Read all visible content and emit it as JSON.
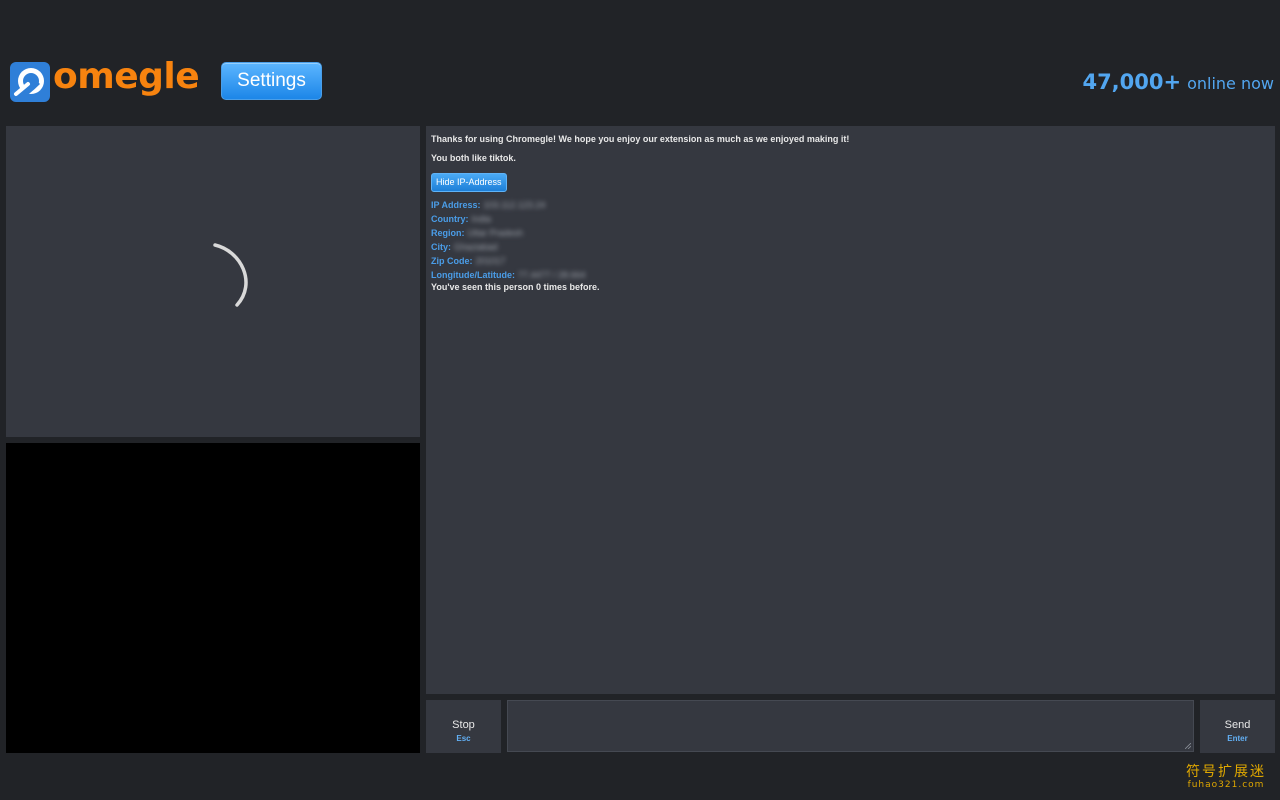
{
  "header": {
    "logo_text": "omegle",
    "settings_label": "Settings",
    "online_count": "47,000+",
    "online_label": "online now"
  },
  "chat": {
    "message_thanks": "Thanks for using Chromegle! We hope you enjoy our extension as much as we enjoyed making it!",
    "message_common": "You both like tiktok.",
    "hide_ip_label": "Hide IP-Address",
    "info": [
      {
        "key": "IP Address:",
        "value": "103.112.123.24"
      },
      {
        "key": "Country:",
        "value": "India"
      },
      {
        "key": "Region:",
        "value": "Uttar Pradesh"
      },
      {
        "key": "City:",
        "value": "Ghaziabad"
      },
      {
        "key": "Zip Code:",
        "value": "201017"
      },
      {
        "key": "Longitude/Latitude:",
        "value": "77.4477 / 28.664"
      }
    ],
    "message_seen": "You've seen this person 0 times before."
  },
  "controls": {
    "stop_label": "Stop",
    "stop_key": "Esc",
    "send_label": "Send",
    "send_key": "Enter",
    "input_value": ""
  },
  "watermark": {
    "cn": "符号扩展迷",
    "en": "fuhao321.com"
  },
  "colors": {
    "accent": "#52a6f0",
    "logo": "#f7830f",
    "panel": "#353840",
    "background": "#212327"
  }
}
